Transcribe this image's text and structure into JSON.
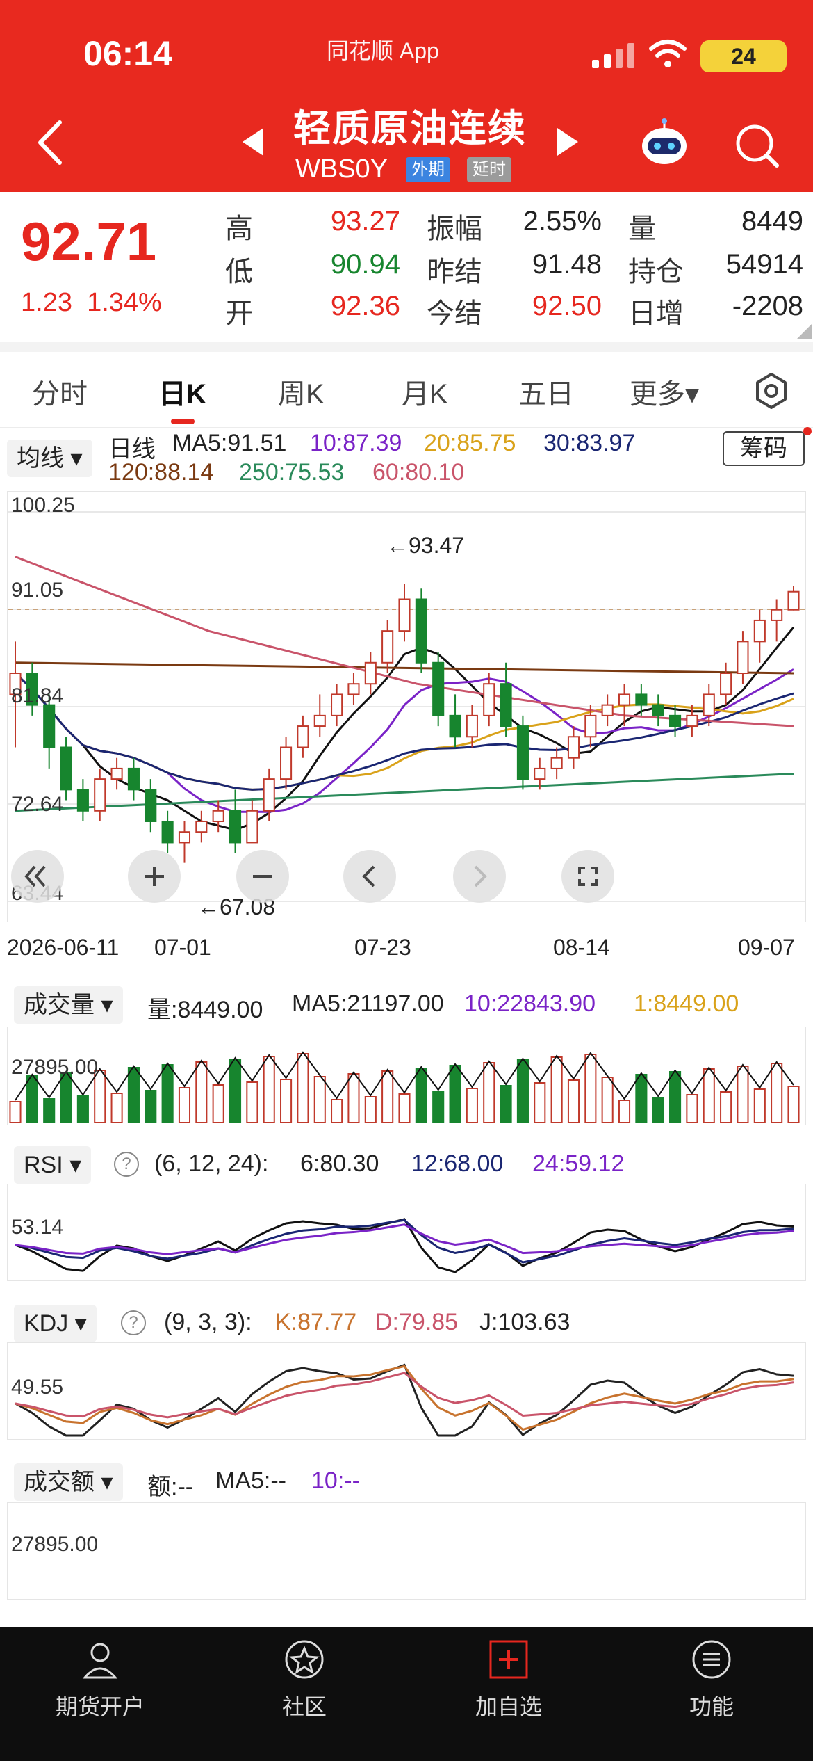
{
  "status_bar": {
    "time": "06:14",
    "app": "同花顺 App",
    "battery": "24"
  },
  "header": {
    "title": "轻质原油连续",
    "code": "WBS0Y",
    "tags": [
      "外期",
      "延时"
    ]
  },
  "quote": {
    "price": "92.71",
    "change": "1.23",
    "change_pct": "1.34%",
    "high_label": "高",
    "high": "93.27",
    "low_label": "低",
    "low": "90.94",
    "open_label": "开",
    "open": "92.36",
    "amp_label": "振幅",
    "amp": "2.55%",
    "prev_label": "昨结",
    "prev": "91.48",
    "settle_label": "今结",
    "settle": "92.50",
    "vol_label": "量",
    "vol": "8449",
    "oi_label": "持仓",
    "oi": "54914",
    "daychg_label": "日增",
    "daychg": "-2208"
  },
  "tabs": [
    "分时",
    "日K",
    "周K",
    "月K",
    "五日",
    "更多▾"
  ],
  "kline": {
    "ma_button": "均线",
    "chip_button": "筹码",
    "legend": [
      "日线",
      "MA5:91.51",
      "10:87.39",
      "20:85.75",
      "30:83.97",
      "120:88.14",
      "250:75.53",
      "60:80.10"
    ],
    "y_labels": [
      "100.25",
      "91.05",
      "81.84",
      "72.64",
      "63.44"
    ],
    "x_labels": [
      "2026-06-11",
      "07-01",
      "07-23",
      "08-14",
      "09-07"
    ],
    "high_annot": "←93.47",
    "low_annot": "←67.08"
  },
  "volume": {
    "button": "成交量",
    "legend": [
      "量:8449.00",
      "MA5:21197.00",
      "10:22843.90",
      "1:8449.00"
    ],
    "y_label": "27895.00"
  },
  "rsi": {
    "button": "RSI",
    "params": "(6, 12, 24):",
    "legend": [
      "6:80.30",
      "12:68.00",
      "24:59.12"
    ],
    "y_label": "53.14"
  },
  "kdj": {
    "button": "KDJ",
    "params": "(9, 3, 3):",
    "legend": [
      "K:87.77",
      "D:79.85",
      "J:103.63"
    ],
    "y_label": "49.55"
  },
  "amount": {
    "button": "成交额",
    "legend": [
      "额:--",
      "MA5:--",
      "10:--"
    ],
    "y_label": "27895.00"
  },
  "bottom_nav": [
    "期货开户",
    "社区",
    "加自选",
    "功能"
  ],
  "chart_data": {
    "type": "candlestick",
    "ylim": [
      63.44,
      100.25
    ],
    "candles": [
      [
        83,
        88,
        78,
        85
      ],
      [
        85,
        86,
        81,
        82
      ],
      [
        82,
        83,
        76,
        78
      ],
      [
        78,
        79,
        73,
        74
      ],
      [
        74,
        75,
        71,
        72
      ],
      [
        72,
        76,
        71,
        75
      ],
      [
        75,
        77,
        74,
        76
      ],
      [
        76,
        77,
        73,
        74
      ],
      [
        74,
        75,
        70,
        71
      ],
      [
        71,
        72,
        68,
        69
      ],
      [
        69,
        71,
        67.08,
        70
      ],
      [
        70,
        72,
        69,
        71
      ],
      [
        71,
        73,
        70,
        72
      ],
      [
        72,
        74,
        68,
        69
      ],
      [
        69,
        73,
        69,
        72
      ],
      [
        72,
        76,
        71,
        75
      ],
      [
        75,
        79,
        74,
        78
      ],
      [
        78,
        81,
        77,
        80
      ],
      [
        80,
        83,
        79,
        81
      ],
      [
        81,
        84,
        80,
        83
      ],
      [
        83,
        85,
        82,
        84
      ],
      [
        84,
        87,
        83,
        86
      ],
      [
        86,
        90,
        85,
        89
      ],
      [
        89,
        93.47,
        88,
        92
      ],
      [
        92,
        93,
        85,
        86
      ],
      [
        86,
        87,
        80,
        81
      ],
      [
        81,
        83,
        78,
        79
      ],
      [
        79,
        82,
        78,
        81
      ],
      [
        81,
        85,
        80,
        84
      ],
      [
        84,
        86,
        79,
        80
      ],
      [
        80,
        81,
        74,
        75
      ],
      [
        75,
        77,
        74,
        76
      ],
      [
        76,
        78,
        75,
        77
      ],
      [
        77,
        80,
        76,
        79
      ],
      [
        79,
        82,
        78,
        81
      ],
      [
        81,
        83,
        80,
        82
      ],
      [
        82,
        84,
        80,
        83
      ],
      [
        83,
        84,
        81,
        82
      ],
      [
        82,
        83,
        80,
        81
      ],
      [
        81,
        82,
        79,
        80
      ],
      [
        80,
        82,
        79,
        81
      ],
      [
        81,
        84,
        80,
        83
      ],
      [
        83,
        86,
        82,
        85
      ],
      [
        85,
        89,
        84,
        88
      ],
      [
        88,
        91,
        86,
        90
      ],
      [
        90,
        92,
        88,
        91
      ],
      [
        91,
        93.27,
        90.94,
        92.71
      ]
    ]
  }
}
